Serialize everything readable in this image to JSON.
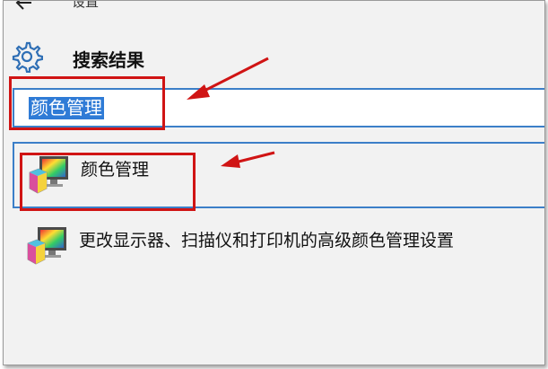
{
  "window": {
    "title": "设置"
  },
  "heading": "搜索结果",
  "search": {
    "value": "颜色管理"
  },
  "results": [
    {
      "label": "颜色管理"
    },
    {
      "label": "更改显示器、扫描仪和打印机的高级颜色管理设置"
    }
  ],
  "colors": {
    "accent": "#3c7fc8",
    "selection": "#2f7bd6",
    "annotation": "#d01414",
    "background": "#f2f2f2"
  },
  "icons": [
    "back-arrow-icon",
    "minimize-icon",
    "gear-icon",
    "color-management-icon"
  ]
}
